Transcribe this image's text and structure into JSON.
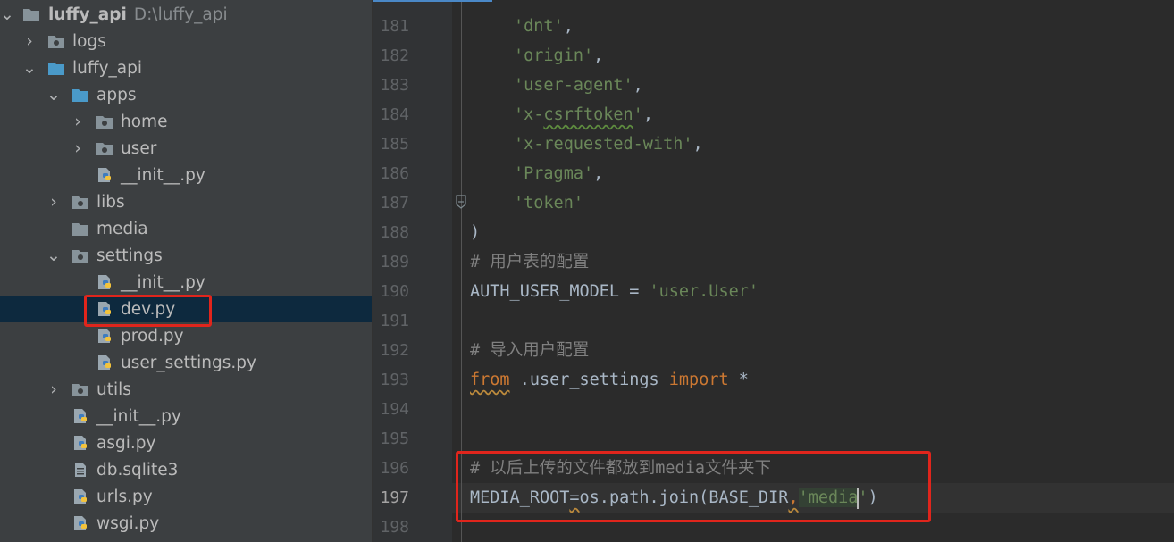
{
  "project_tree": {
    "items": [
      {
        "label": "luffy_api",
        "type": "folder",
        "expanded": true,
        "path": "D:\\luffy_api"
      },
      {
        "label": "logs",
        "type": "folder",
        "expanded": false
      },
      {
        "label": "luffy_api",
        "type": "folder",
        "expanded": true
      },
      {
        "label": "apps",
        "type": "folder",
        "expanded": true
      },
      {
        "label": "home",
        "type": "folder",
        "expanded": false
      },
      {
        "label": "user",
        "type": "folder",
        "expanded": false
      },
      {
        "label": "__init__.py",
        "type": "python-file"
      },
      {
        "label": "libs",
        "type": "folder",
        "expanded": false
      },
      {
        "label": "media",
        "type": "folder"
      },
      {
        "label": "settings",
        "type": "folder",
        "expanded": true
      },
      {
        "label": "__init__.py",
        "type": "python-file"
      },
      {
        "label": "dev.py",
        "type": "python-file",
        "selected": true
      },
      {
        "label": "prod.py",
        "type": "python-file"
      },
      {
        "label": "user_settings.py",
        "type": "python-file"
      },
      {
        "label": "utils",
        "type": "folder",
        "expanded": false
      },
      {
        "label": "__init__.py",
        "type": "python-file"
      },
      {
        "label": "asgi.py",
        "type": "python-file"
      },
      {
        "label": "db.sqlite3",
        "type": "db-file"
      },
      {
        "label": "urls.py",
        "type": "python-file"
      },
      {
        "label": "wsgi.py",
        "type": "python-file"
      }
    ]
  },
  "editor": {
    "line_numbers": [
      "181",
      "182",
      "183",
      "184",
      "185",
      "186",
      "187",
      "188",
      "189",
      "190",
      "191",
      "192",
      "193",
      "194",
      "195",
      "196",
      "197",
      "198"
    ],
    "current_line": "197",
    "lines": {
      "l181": "'dnt'",
      "l182": "'origin'",
      "l183": "'user-agent'",
      "l184_a": "'x-",
      "l184_b": "csrftoken",
      "l184_c": "'",
      "l185": "'x-requested-with'",
      "l186": "'Pragma'",
      "l187": "'token'",
      "l188": ")",
      "l189": "# 用户表的配置",
      "l190_a": "AUTH_USER_MODEL = ",
      "l190_b": "'user.User'",
      "l192": "# 导入用户配置",
      "l193_a": "from",
      "l193_b": " .user_settings ",
      "l193_c": "import",
      "l193_d": " *",
      "l196": "# 以后上传的文件都放到media文件夹下",
      "l197_a": "MEDIA_ROOT",
      "l197_b": "=",
      "l197_c": "os.path.join(BASE_DIR",
      "l197_d": ",",
      "l197_e": "'media",
      "l197_f": "'",
      "l197_g": ")"
    }
  },
  "colors": {
    "highlight_box": "#e0251c",
    "string": "#6a8759",
    "keyword": "#cc7832",
    "comment": "#808080",
    "text": "#a9b7c6"
  }
}
